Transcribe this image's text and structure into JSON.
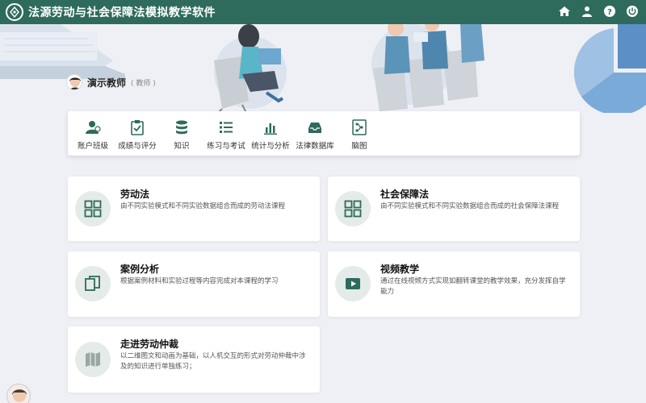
{
  "app": {
    "title": "法源劳动与社会保障法模拟教学软件",
    "accent_color": "#2e6b5c",
    "actions": [
      {
        "icon": "home-icon"
      },
      {
        "icon": "user-icon"
      },
      {
        "icon": "help-icon"
      },
      {
        "icon": "power-icon"
      }
    ]
  },
  "user": {
    "name": "演示教师",
    "role": "( 教师 )"
  },
  "toolbar": {
    "items": [
      {
        "label": "账户班级",
        "icon": "users-icon"
      },
      {
        "label": "成绩与评分",
        "icon": "clipboard-check-icon"
      },
      {
        "label": "知识",
        "icon": "database-icon"
      },
      {
        "label": "练习与考试",
        "icon": "list-icon"
      },
      {
        "label": "统计与分析",
        "icon": "bar-chart-icon"
      },
      {
        "label": "法律数据库",
        "icon": "inbox-icon"
      },
      {
        "label": "脑图",
        "icon": "mindmap-icon"
      }
    ]
  },
  "cards": [
    {
      "title": "劳动法",
      "desc": "由不同实验模式和不同实验数据组合而成的劳动法课程",
      "icon": "grid-icon"
    },
    {
      "title": "社会保障法",
      "desc": "由不同实验模式和不同实验数据组合而成的社会保障法课程",
      "icon": "grid-icon"
    },
    {
      "title": "案例分析",
      "desc": "根据案例材料和实验过程等内容完成对本课程的学习",
      "icon": "copy-icon"
    },
    {
      "title": "视频教学",
      "desc": "通过在线视频方式实现如翻转课堂的教学效果，充分发挥自学能力",
      "icon": "video-icon"
    },
    {
      "title": "走进劳动仲裁",
      "desc": "以二维图文和动画为基础，以人机交互的形式对劳动仲裁中涉及的知识进行单独练习；",
      "icon": "map-icon"
    }
  ]
}
